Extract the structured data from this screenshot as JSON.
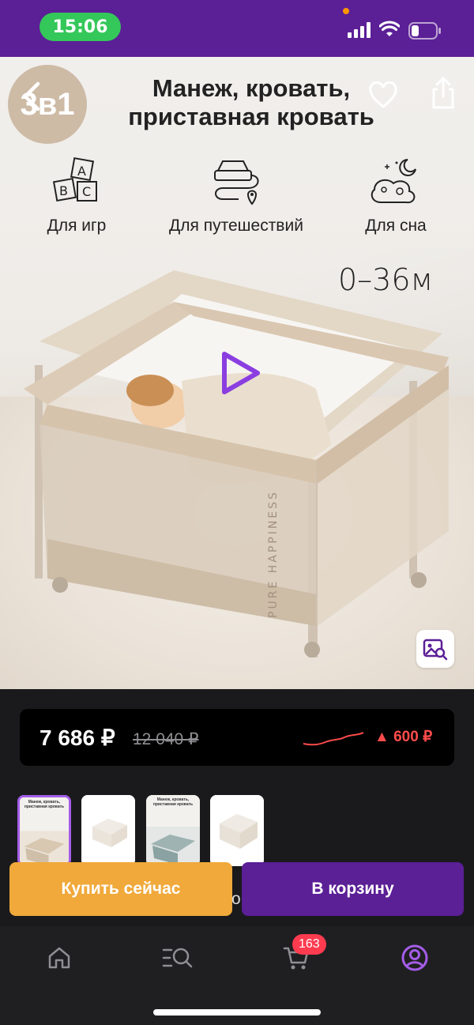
{
  "status_bar": {
    "time": "15:06",
    "pill_color": "#34c759",
    "bg": "#5b1f96"
  },
  "hero": {
    "badge": "3в1",
    "title_line1": "Манеж, кровать,",
    "title_line2": "приставная кровать",
    "features": [
      {
        "icon": "abc-blocks-icon",
        "label": "Для игр"
      },
      {
        "icon": "car-route-icon",
        "label": "Для путешествий"
      },
      {
        "icon": "sleep-moon-icon",
        "label": "Для сна"
      }
    ],
    "age_range": "0–36м",
    "crib_print": "PURE HAPPINESS"
  },
  "price": {
    "current": "7 686 ₽",
    "old": "12 040 ₽",
    "change": "▲ 600 ₽",
    "change_color": "#ff4b4b"
  },
  "thumbnails": [
    {
      "title": "Манеж, кровать, приставная кровать",
      "active": true
    },
    {
      "title": "",
      "active": false
    },
    {
      "title": "Манеж, кровать, приставная кровать",
      "active": false
    },
    {
      "title": "",
      "active": false
    }
  ],
  "actions": {
    "buy_now": "Купить сейчас",
    "peek_text": "о",
    "to_cart": "В корзину",
    "buy_color": "#f0a93a",
    "cart_color": "#5b1f96"
  },
  "bottom_nav": {
    "items": [
      {
        "icon": "home-icon"
      },
      {
        "icon": "catalog-search-icon"
      },
      {
        "icon": "cart-icon"
      },
      {
        "icon": "profile-icon"
      }
    ],
    "cart_count": "163",
    "active_color": "#a45de8"
  }
}
